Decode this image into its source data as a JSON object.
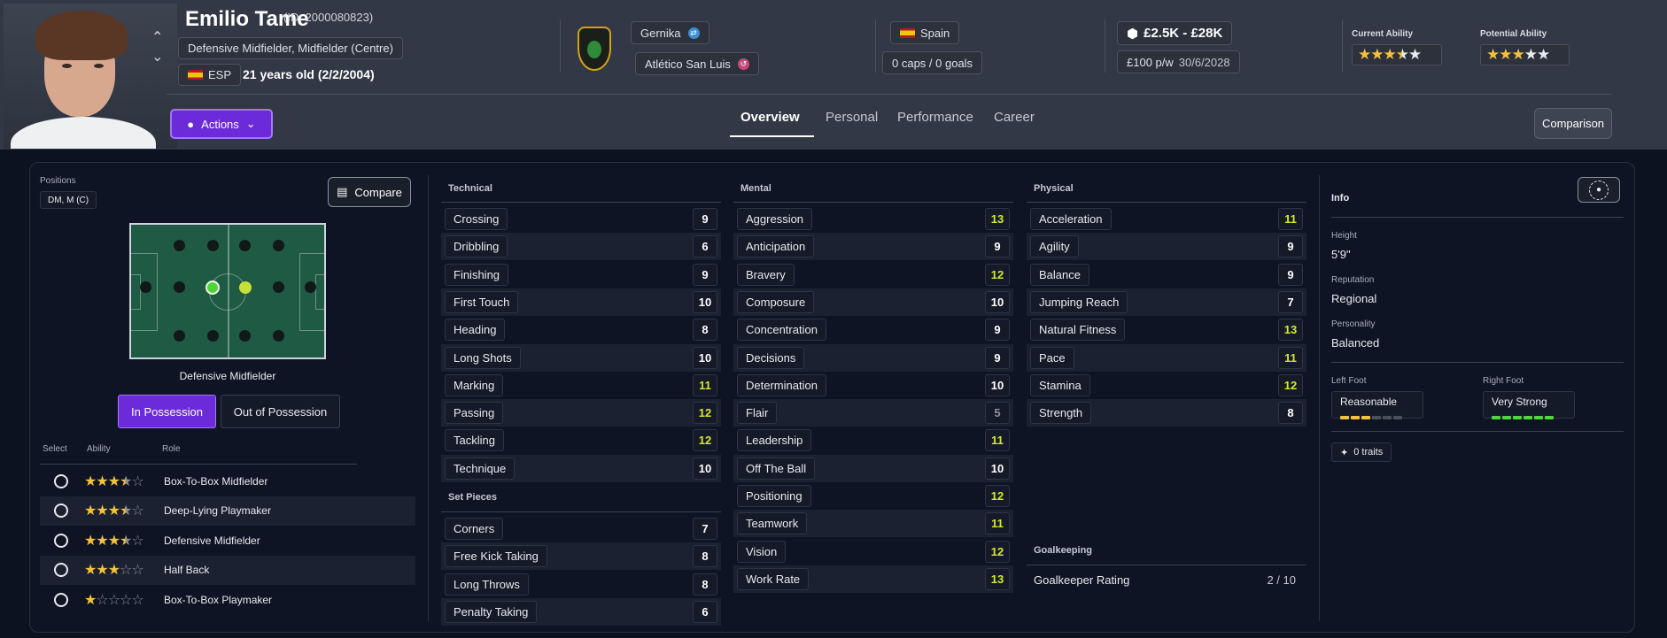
{
  "player": {
    "name": "Emilio Tame",
    "id": "(ID: 2000080823)",
    "positions": "Defensive Midfielder, Midfielder (Centre)",
    "nation_code": "ESP",
    "age": "21 years old (2/2/2004)"
  },
  "club": {
    "name": "Gernika",
    "loan_club": "Atlético San Luis"
  },
  "nation": {
    "name": "Spain",
    "caps": "0 caps / 0 goals"
  },
  "contract": {
    "value_range": "£2.5K - £28K",
    "wage": "£100 p/w",
    "expiry": "30/6/2028"
  },
  "ability": {
    "current_label": "Current Ability",
    "current_stars": 3.5,
    "potential_label": "Potential Ability",
    "potential_stars": 3
  },
  "actions_label": "Actions",
  "tabs": [
    {
      "label": "Overview",
      "active": true
    },
    {
      "label": "Personal"
    },
    {
      "label": "Performance"
    },
    {
      "label": "Career"
    }
  ],
  "comparison_label": "Comparison",
  "positions_panel": {
    "label": "Positions",
    "value": "DM, M (C)",
    "compare_label": "Compare",
    "role_title": "Defensive Midfielder",
    "toggle_in": "In Possession",
    "toggle_out": "Out of Possession",
    "col_select": "Select",
    "col_ability": "Ability",
    "col_role": "Role",
    "roles": [
      {
        "name": "Box-To-Box Midfielder",
        "stars": 3.5
      },
      {
        "name": "Deep-Lying Playmaker",
        "stars": 3.5
      },
      {
        "name": "Defensive Midfielder",
        "stars": 3.5
      },
      {
        "name": "Half Back",
        "stars": 3
      },
      {
        "name": "Box-To-Box Playmaker",
        "stars": 1
      }
    ]
  },
  "technical": {
    "title": "Technical",
    "attrs": [
      {
        "name": "Crossing",
        "value": "9"
      },
      {
        "name": "Dribbling",
        "value": "6"
      },
      {
        "name": "Finishing",
        "value": "9"
      },
      {
        "name": "First Touch",
        "value": "10"
      },
      {
        "name": "Heading",
        "value": "8"
      },
      {
        "name": "Long Shots",
        "value": "10"
      },
      {
        "name": "Marking",
        "value": "11"
      },
      {
        "name": "Passing",
        "value": "12"
      },
      {
        "name": "Tackling",
        "value": "12"
      },
      {
        "name": "Technique",
        "value": "10"
      }
    ]
  },
  "set_pieces": {
    "title": "Set Pieces",
    "attrs": [
      {
        "name": "Corners",
        "value": "7"
      },
      {
        "name": "Free Kick Taking",
        "value": "8"
      },
      {
        "name": "Long Throws",
        "value": "8"
      },
      {
        "name": "Penalty Taking",
        "value": "6"
      }
    ]
  },
  "mental": {
    "title": "Mental",
    "attrs": [
      {
        "name": "Aggression",
        "value": "13"
      },
      {
        "name": "Anticipation",
        "value": "9"
      },
      {
        "name": "Bravery",
        "value": "12"
      },
      {
        "name": "Composure",
        "value": "10"
      },
      {
        "name": "Concentration",
        "value": "9"
      },
      {
        "name": "Decisions",
        "value": "9"
      },
      {
        "name": "Determination",
        "value": "10"
      },
      {
        "name": "Flair",
        "value": "5"
      },
      {
        "name": "Leadership",
        "value": "11"
      },
      {
        "name": "Off The Ball",
        "value": "10"
      },
      {
        "name": "Positioning",
        "value": "12"
      },
      {
        "name": "Teamwork",
        "value": "11"
      },
      {
        "name": "Vision",
        "value": "12"
      },
      {
        "name": "Work Rate",
        "value": "13"
      }
    ]
  },
  "physical": {
    "title": "Physical",
    "attrs": [
      {
        "name": "Acceleration",
        "value": "11"
      },
      {
        "name": "Agility",
        "value": "9"
      },
      {
        "name": "Balance",
        "value": "9"
      },
      {
        "name": "Jumping Reach",
        "value": "7"
      },
      {
        "name": "Natural Fitness",
        "value": "13"
      },
      {
        "name": "Pace",
        "value": "11"
      },
      {
        "name": "Stamina",
        "value": "12"
      },
      {
        "name": "Strength",
        "value": "8"
      }
    ]
  },
  "goalkeeping": {
    "title": "Goalkeeping",
    "label": "Goalkeeper Rating",
    "value": "2 / 10"
  },
  "info": {
    "title": "Info",
    "height_label": "Height",
    "height": "5'9\"",
    "reputation_label": "Reputation",
    "reputation": "Regional",
    "personality_label": "Personality",
    "personality": "Balanced",
    "left_foot_label": "Left Foot",
    "left_foot": "Reasonable",
    "left_foot_level": 3,
    "right_foot_label": "Right Foot",
    "right_foot": "Very Strong",
    "right_foot_level": 6,
    "traits": "0 traits"
  },
  "colors": {
    "accent": "#6c2bd9",
    "attr_high": "#d6e82a",
    "attr_normal": "#ffffff",
    "attr_low": "#8a8f99"
  }
}
